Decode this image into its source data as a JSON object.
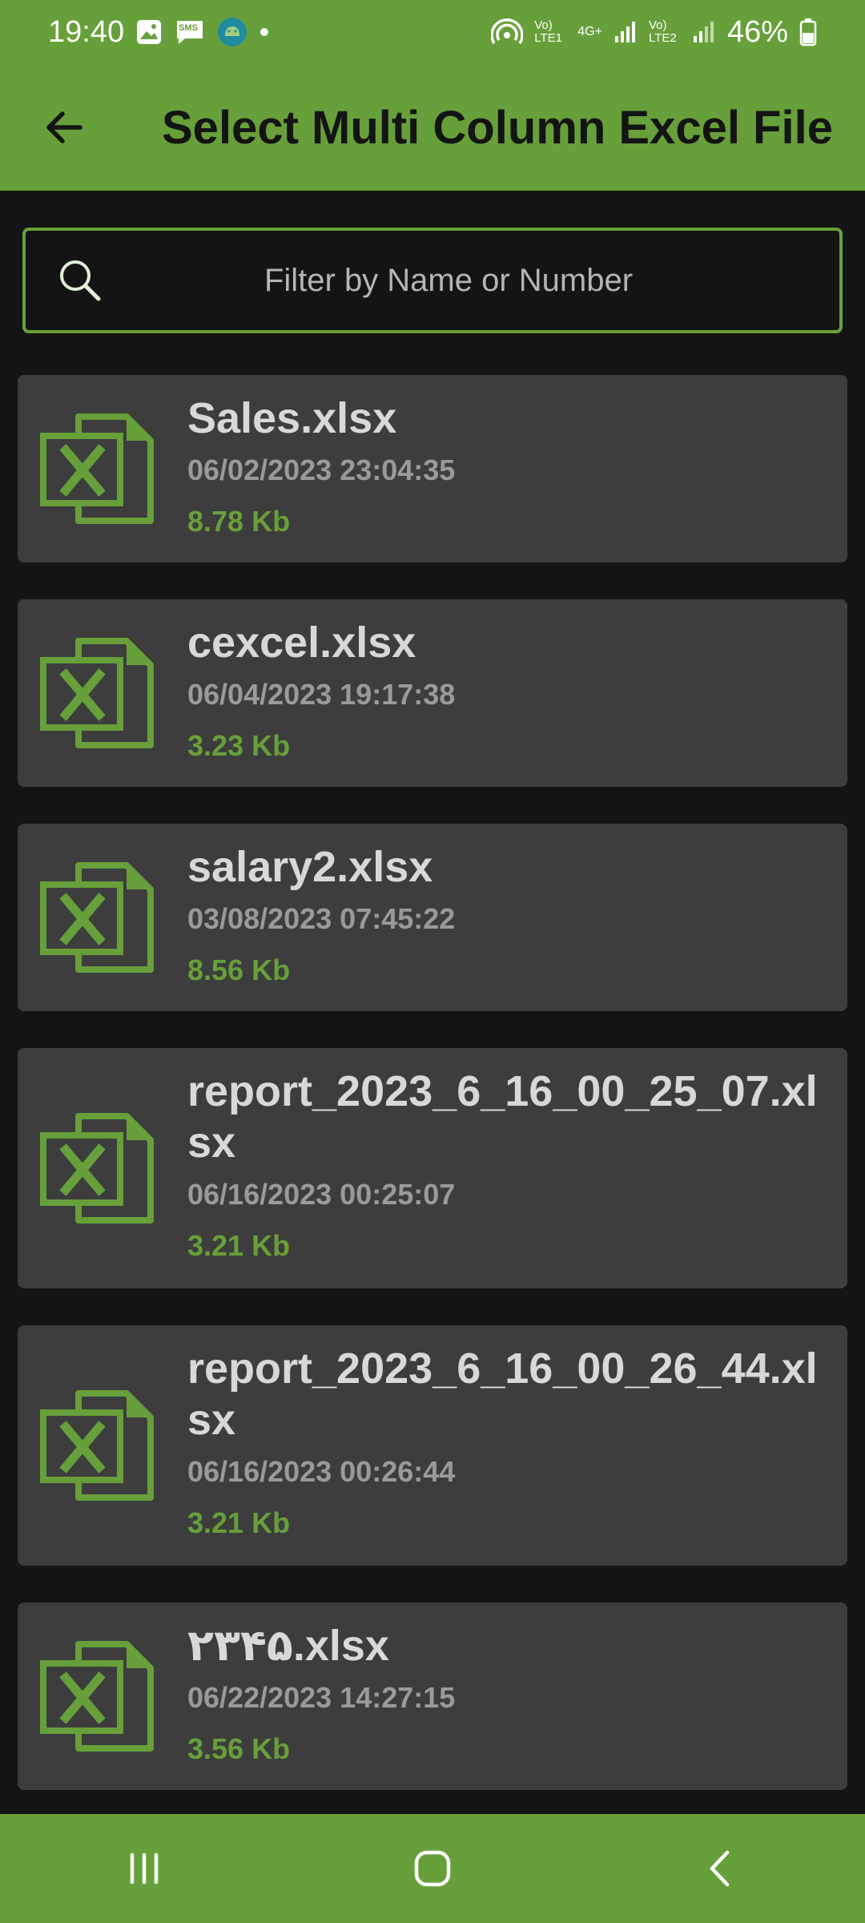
{
  "status_bar": {
    "time": "19:40",
    "battery_percent": "46%",
    "sim1_label": "Vo) LTE1",
    "network_label": "4G+",
    "sim2_label": "Vo) LTE2",
    "sms_label": "SMS"
  },
  "app_bar": {
    "title": "Select Multi Column Excel File"
  },
  "search": {
    "placeholder": "Filter by Name or Number",
    "value": ""
  },
  "files": [
    {
      "name": "Sales.xlsx",
      "date": "06/02/2023 23:04:35",
      "size": "8.78 Kb"
    },
    {
      "name": "cexcel.xlsx",
      "date": "06/04/2023 19:17:38",
      "size": "3.23 Kb"
    },
    {
      "name": "salary2.xlsx",
      "date": "03/08/2023 07:45:22",
      "size": "8.56 Kb"
    },
    {
      "name": "report_2023_6_16_00_25_07.xlsx",
      "date": "06/16/2023 00:25:07",
      "size": "3.21 Kb"
    },
    {
      "name": "report_2023_6_16_00_26_44.xlsx",
      "date": "06/16/2023 00:26:44",
      "size": "3.21 Kb"
    },
    {
      "name": "۲۳۴۵.xlsx",
      "date": "06/22/2023 14:27:15",
      "size": "3.56 Kb"
    }
  ],
  "colors": {
    "accent": "#67a03a",
    "background": "#141414",
    "card": "#3d3d3d"
  },
  "icons": {
    "back": "arrow-left-icon",
    "search": "search-icon",
    "file": "excel-file-icon",
    "nav_recents": "recents-icon",
    "nav_home": "home-icon",
    "nav_back": "chevron-left-icon"
  }
}
